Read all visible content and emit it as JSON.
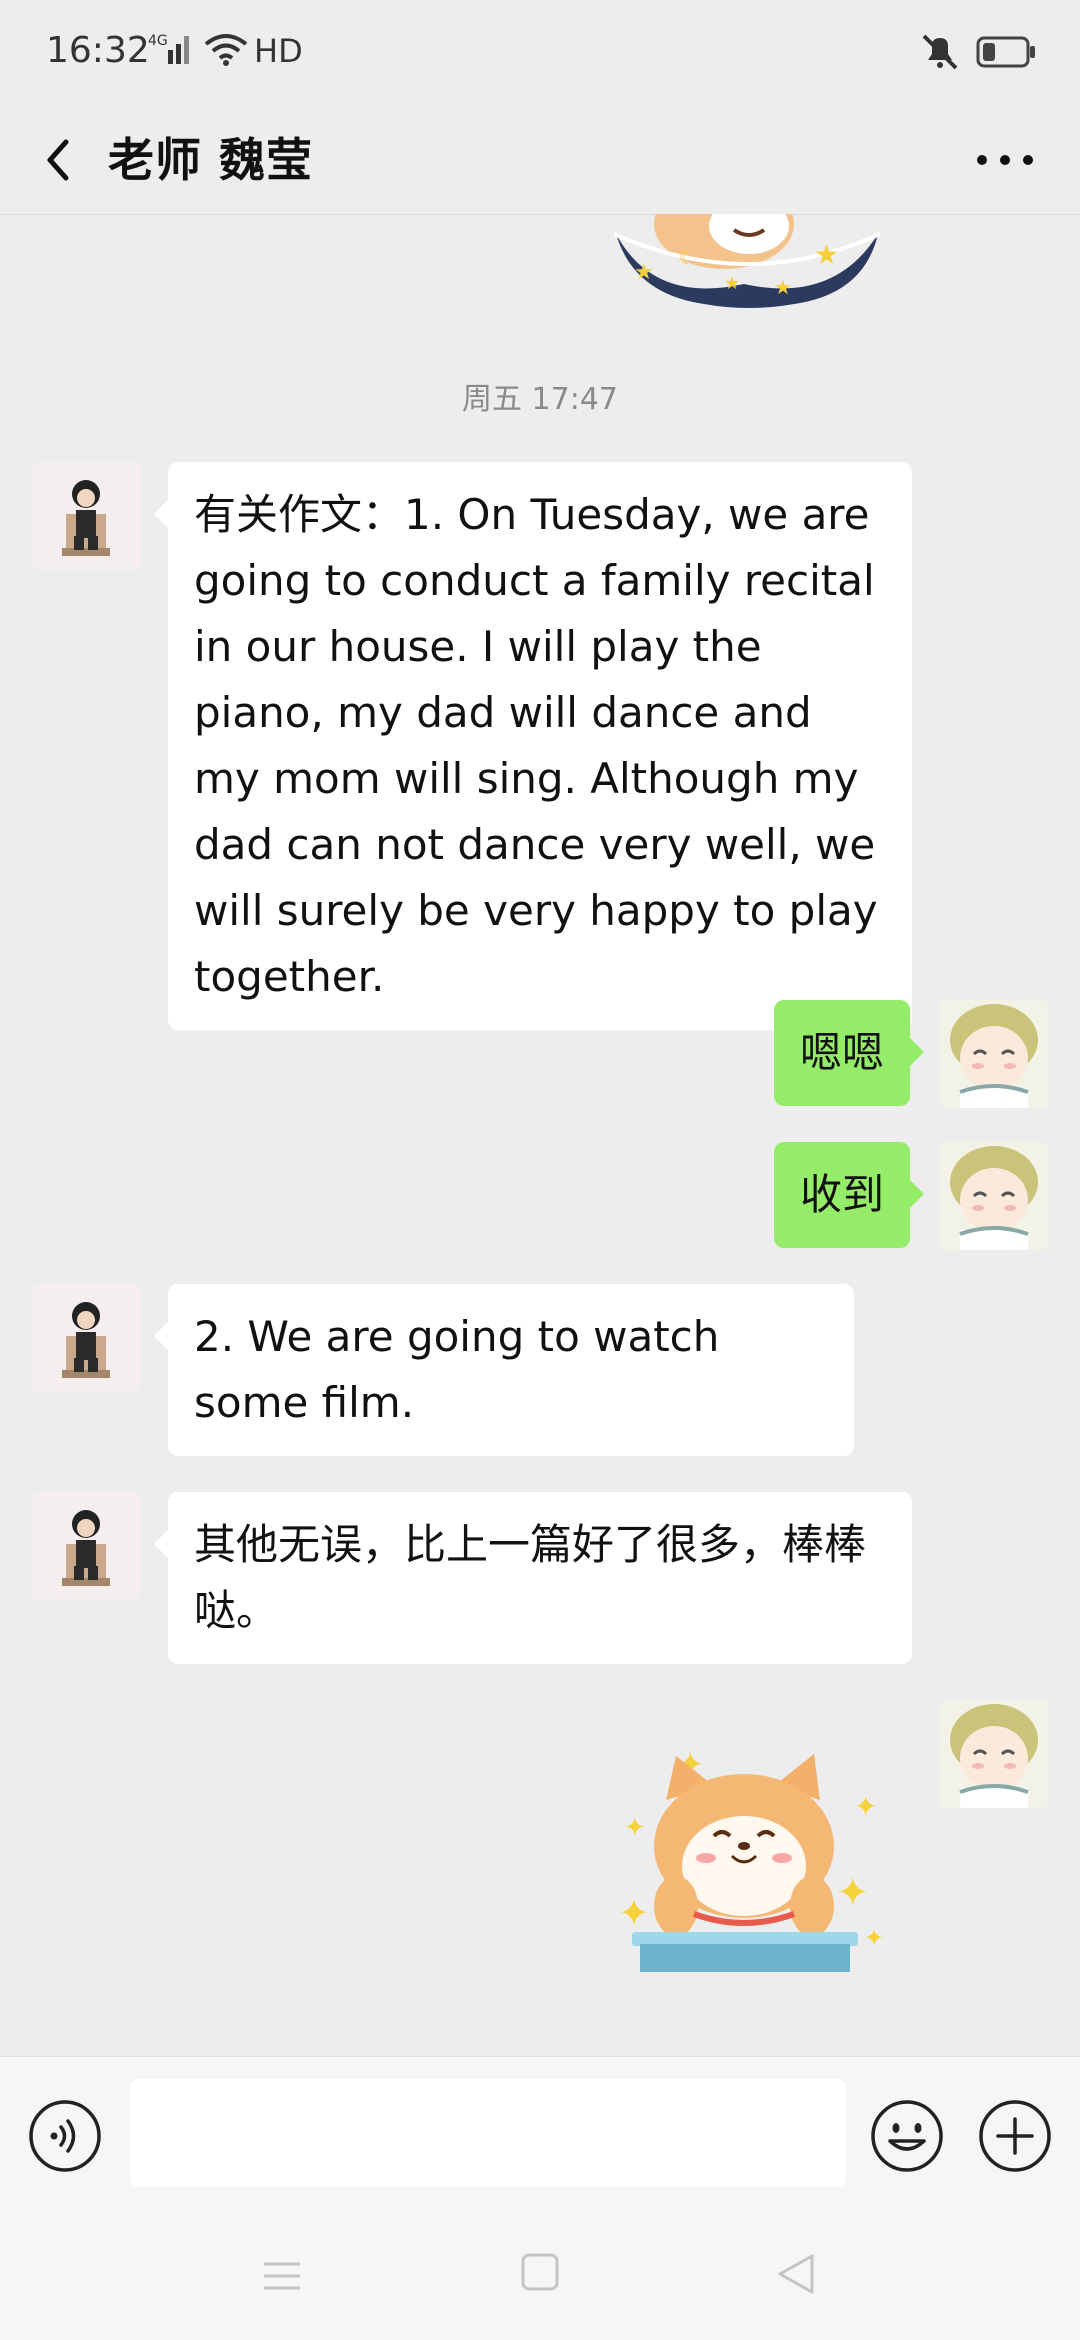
{
  "status_bar": {
    "time": "16:32",
    "network": "4G",
    "hd": "HD",
    "icons": [
      "signal-icon",
      "wifi-icon",
      "mute-icon",
      "battery-icon"
    ]
  },
  "header": {
    "title": "老师  魏莹",
    "back_icon": "back-icon",
    "more_icon": "more-icon"
  },
  "chat": {
    "timestamp": "周五 17:47",
    "messages": [
      {
        "side": "left",
        "text": "有关作文：1. On Tuesday, we are going to conduct a family recital in our house. I will play the piano, my dad will dance and my mom will sing. Although my dad can not dance very well, we will surely be very happy to play together."
      },
      {
        "side": "right",
        "text": "嗯嗯"
      },
      {
        "side": "right",
        "text": "收到"
      },
      {
        "side": "left",
        "text": "2. We are going to watch some film."
      },
      {
        "side": "left",
        "text": "其他无误，比上一篇好了很多，棒棒哒。"
      },
      {
        "side": "right",
        "sticker": "shiba-dog-sticker"
      }
    ]
  },
  "input_bar": {
    "placeholder": "",
    "icons": [
      "voice-icon",
      "emoji-icon",
      "plus-icon"
    ]
  },
  "nav_bar": {
    "icons": [
      "menu-icon",
      "home-icon",
      "back-nav-icon"
    ]
  },
  "colors": {
    "background": "#ededed",
    "my_bubble": "#95ec69",
    "their_bubble": "#ffffff"
  }
}
